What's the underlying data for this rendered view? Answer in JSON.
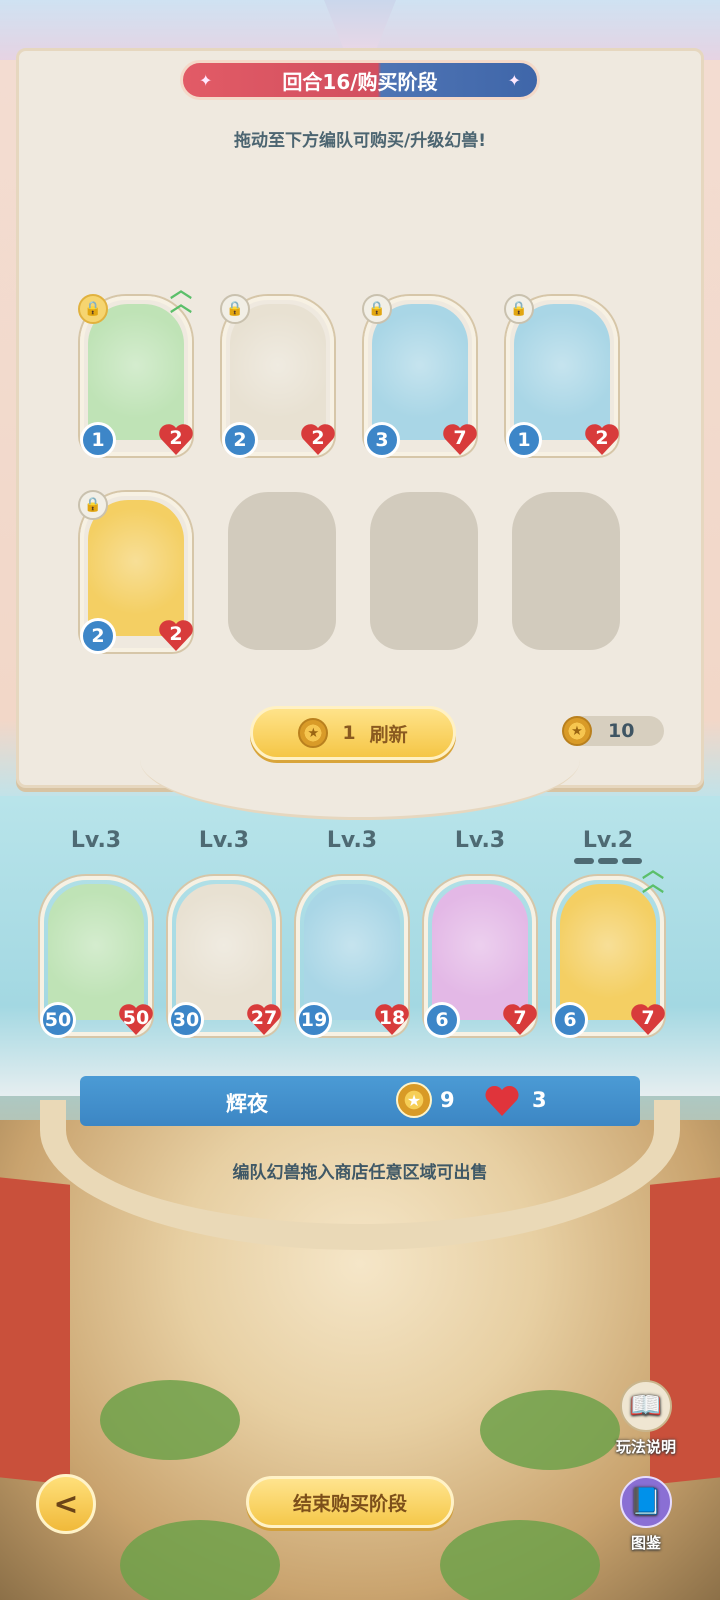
{
  "header": {
    "title": "回合16/购买阶段",
    "subtitle": "拖动至下方编队可购买/升级幻兽!"
  },
  "shop": {
    "cards": [
      {
        "atk": "1",
        "hp": "2",
        "lock": "locked-gold",
        "upgrade": true,
        "bg": "#bfe3b6"
      },
      {
        "atk": "2",
        "hp": "2",
        "lock": "unlocked",
        "upgrade": false,
        "bg": "#e8e1d2"
      },
      {
        "atk": "3",
        "hp": "7",
        "lock": "unlocked",
        "upgrade": false,
        "bg": "#a9d6e6"
      },
      {
        "atk": "1",
        "hp": "2",
        "lock": "unlocked",
        "upgrade": false,
        "bg": "#a9d6e6"
      },
      {
        "atk": "2",
        "hp": "2",
        "lock": "unlocked",
        "upgrade": false,
        "bg": "#f4cf63"
      }
    ],
    "empty_slots": 3,
    "refresh": {
      "cost": "1",
      "label": "刷新"
    },
    "coins": "10"
  },
  "team": {
    "members": [
      {
        "level": "Lv.3",
        "atk": "50",
        "hp": "50",
        "bg": "#bfe3b6"
      },
      {
        "level": "Lv.3",
        "atk": "30",
        "hp": "27",
        "bg": "#e8e1d2"
      },
      {
        "level": "Lv.3",
        "atk": "19",
        "hp": "18",
        "bg": "#a9d6e6"
      },
      {
        "level": "Lv.3",
        "atk": "6",
        "hp": "7",
        "bg": "#e3b8e6"
      },
      {
        "level": "Lv.2",
        "atk": "6",
        "hp": "7",
        "bg": "#f4cf63"
      }
    ],
    "player_name": "辉夜",
    "medals": "9",
    "lives": "3",
    "hint": "编队幻兽拖入商店任意区域可出售"
  },
  "footer": {
    "back_icon": "back-arrow-icon",
    "end_button": "结束购买阶段",
    "guide_label": "玩法说明",
    "guide_icon": "book-icon",
    "codex_label": "图鉴",
    "codex_icon": "codex-icon"
  },
  "colors": {
    "atk": "#3d86c8",
    "hp": "#d83b3b",
    "button_gold": "#f5c646",
    "ribbon_red": "#e25b66",
    "ribbon_blue": "#3f66a9"
  }
}
